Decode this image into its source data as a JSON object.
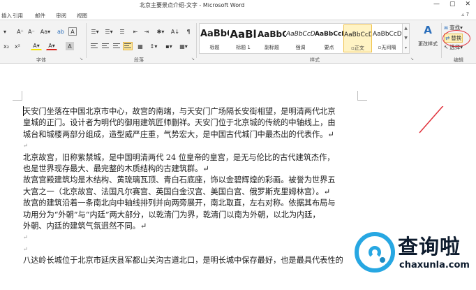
{
  "window": {
    "title": "北京主要景点介绍-文字 - Microsoft Word",
    "controls": [
      "—",
      "▢",
      "✕"
    ]
  },
  "tabs": [
    "插入",
    "引用",
    "邮件",
    "审阅",
    "视图"
  ],
  "ribbon": {
    "font_group": {
      "label": "字体",
      "row1": [
        "A⁺",
        "A⁻",
        "Aa▾",
        "ab",
        "A"
      ],
      "row2": [
        "x₂",
        "x²",
        "A▾",
        "A▾"
      ]
    },
    "paragraph_group": {
      "label": "段落",
      "row1": [
        "☰▾",
        "☰▾",
        "☰",
        "⇤",
        "⇥",
        "✱▾",
        "A↓",
        "¶"
      ],
      "row2": [
        "≡",
        "≡",
        "≡",
        "≡",
        "▦",
        "↕▾",
        "▪▾",
        "▦▾"
      ]
    },
    "styles_group": {
      "label": "样式",
      "items": [
        {
          "sample": "AaBbC",
          "name": "标题",
          "size": "13px",
          "weight": "bold"
        },
        {
          "sample": "AaBl",
          "name": "标题 1",
          "size": "15px",
          "weight": "bold"
        },
        {
          "sample": "AaBbC",
          "name": "副标题",
          "size": "12px",
          "weight": "bold"
        },
        {
          "sample": "AaBbCcDc",
          "name": "强调",
          "size": "9px",
          "weight": "normal"
        },
        {
          "sample": "AaBbCcD",
          "name": "要点",
          "size": "9px",
          "weight": "bold"
        },
        {
          "sample": "AaBbCcDc",
          "name": "▫正文",
          "size": "9px",
          "weight": "normal"
        },
        {
          "sample": "AaBbCcDc",
          "name": "▫无间隔",
          "size": "9px",
          "weight": "normal"
        }
      ],
      "change_styles": "更改样式"
    },
    "editing_group": {
      "label": "编辑",
      "find": "查找▾",
      "replace": "替换",
      "select": "选择▾"
    }
  },
  "document": {
    "paragraphs": [
      "天安门坐落在中国北京市中心，故宫的南端，与天安门广场隔长安街相望，是明清两代北京",
      "皇城的正门。设计者为明代的御用建筑匠师蒯祥。天安门位于北京城的传统的中轴线上，由",
      "城台和城楼两部分组成，造型威严庄重，气势宏大，是中国古代城门中最杰出的代表作。↵",
      "↵",
      "北京故宫，旧称紫禁城，是中国明清两代 24 位皇帝的皇宫，是无与伦比的古代建筑杰作，",
      "也是世界现存最大、最完整的木质结构的古建筑群。↵",
      "故宫宫殿建筑均是木结构、黄琉璃瓦顶、青白石底座，饰以金碧辉煌的彩画。被誉为世界五",
      "大宫之一（北京故宫、法国凡尔赛宫、英国白金汉宫、美国白宫、俄罗斯克里姆林宫）。↵",
      "故宫的建筑沿着一条南北向中轴线排列并向两旁展开，南北取直，左右对称。依据其布局与",
      "功用分为“外朝”与“内廷”两大部分，以乾清门为界，乾清门以南为外朝，以北为内廷，",
      "外朝、内廷的建筑气氛迥然不同。↵",
      "↵",
      "↵",
      "八达岭长城位于北京市延庆县军都山关沟古道北口，是明长城中保存最好，也是最具代表性的"
    ]
  },
  "watermark": {
    "text": "查询啦",
    "url": "chaxunla.com",
    "color": "#27a7e2"
  },
  "colors": {
    "annotation": "#e0303a",
    "accent": "#2a6ebb",
    "selected_style": "#fff3c4"
  }
}
